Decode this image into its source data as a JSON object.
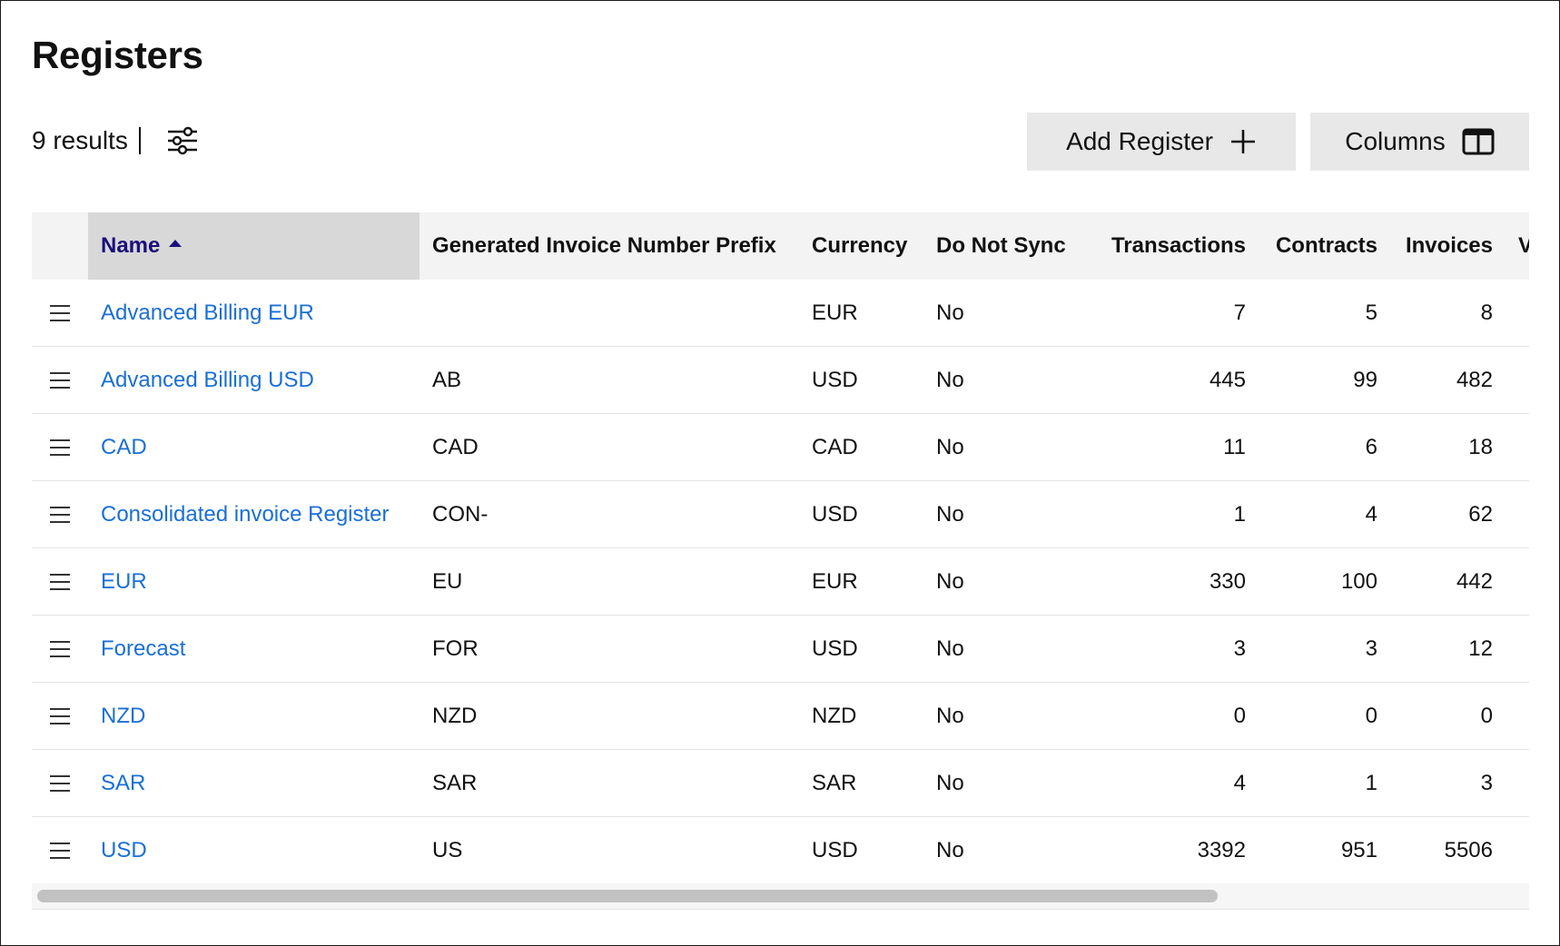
{
  "page": {
    "title": "Registers"
  },
  "toolbar": {
    "results_text": "9 results",
    "add_register_label": "Add Register",
    "columns_label": "Columns",
    "filter_icon": "sliders-icon",
    "add_icon": "plus-icon",
    "columns_icon": "columns-icon"
  },
  "table": {
    "columns": [
      "Name",
      "Generated Invoice Number Prefix",
      "Currency",
      "Do Not Sync",
      "Transactions",
      "Contracts",
      "Invoices",
      "Ve"
    ],
    "sorted_column": "Name",
    "sort_direction": "ascending",
    "rows": [
      {
        "name": "Advanced Billing EUR",
        "prefix": "",
        "currency": "EUR",
        "do_not_sync": "No",
        "transactions": "7",
        "contracts": "5",
        "invoices": "8"
      },
      {
        "name": "Advanced Billing USD",
        "prefix": "AB",
        "currency": "USD",
        "do_not_sync": "No",
        "transactions": "445",
        "contracts": "99",
        "invoices": "482"
      },
      {
        "name": "CAD",
        "prefix": "CAD",
        "currency": "CAD",
        "do_not_sync": "No",
        "transactions": "11",
        "contracts": "6",
        "invoices": "18"
      },
      {
        "name": "Consolidated invoice Register",
        "prefix": "CON-",
        "currency": "USD",
        "do_not_sync": "No",
        "transactions": "1",
        "contracts": "4",
        "invoices": "62"
      },
      {
        "name": "EUR",
        "prefix": "EU",
        "currency": "EUR",
        "do_not_sync": "No",
        "transactions": "330",
        "contracts": "100",
        "invoices": "442"
      },
      {
        "name": "Forecast",
        "prefix": "FOR",
        "currency": "USD",
        "do_not_sync": "No",
        "transactions": "3",
        "contracts": "3",
        "invoices": "12"
      },
      {
        "name": "NZD",
        "prefix": "NZD",
        "currency": "NZD",
        "do_not_sync": "No",
        "transactions": "0",
        "contracts": "0",
        "invoices": "0"
      },
      {
        "name": "SAR",
        "prefix": "SAR",
        "currency": "SAR",
        "do_not_sync": "No",
        "transactions": "4",
        "contracts": "1",
        "invoices": "3"
      },
      {
        "name": "USD",
        "prefix": "US",
        "currency": "USD",
        "do_not_sync": "No",
        "transactions": "3392",
        "contracts": "951",
        "invoices": "5506"
      }
    ]
  },
  "colors": {
    "link": "#1a6fd6",
    "sorted_header_text": "#1a0f7a",
    "button_bg": "#e8e8e8",
    "header_bg": "#f3f3f3"
  }
}
